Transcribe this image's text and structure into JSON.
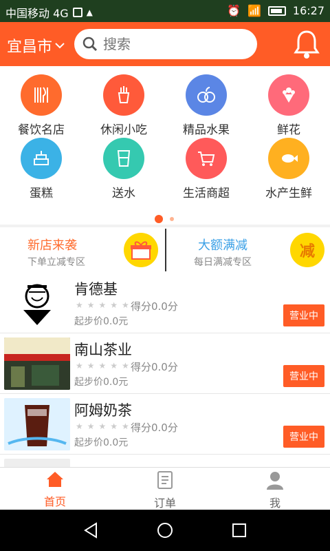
{
  "status_bar": {
    "carrier": "中国移动 4G",
    "time": "16:27"
  },
  "header": {
    "city": "宜昌市",
    "search_placeholder": "搜索"
  },
  "categories": [
    {
      "label": "餐饮名店",
      "color": "#ff6b2d",
      "icon": "utensils-icon"
    },
    {
      "label": "休闲小吃",
      "color": "#ff5a3a",
      "icon": "fries-icon"
    },
    {
      "label": "精品水果",
      "color": "#5b86e5",
      "icon": "fruit-icon"
    },
    {
      "label": "鲜花",
      "color": "#ff6a7a",
      "icon": "flower-icon"
    },
    {
      "label": "蛋糕",
      "color": "#3bb2e6",
      "icon": "cake-icon"
    },
    {
      "label": "送水",
      "color": "#35c9b0",
      "icon": "water-cup-icon"
    },
    {
      "label": "生活商超",
      "color": "#ff5a5a",
      "icon": "cart-icon"
    },
    {
      "label": "水产生鲜",
      "color": "#ffb020",
      "icon": "fish-icon"
    }
  ],
  "promos": [
    {
      "title": "新店来袭",
      "subtitle": "下单立减专区",
      "title_color": "#ff6b2d",
      "icon": "gift-box-icon"
    },
    {
      "title": "大额满减",
      "subtitle": "每日满减专区",
      "title_color": "#3aa0e6",
      "badge": "减",
      "icon": "discount-badge-icon"
    }
  ],
  "stores": [
    {
      "name": "肯德基",
      "score": "得分0.0分",
      "min_price": "起步价0.0元",
      "status": "营业中"
    },
    {
      "name": "南山茶业",
      "score": "得分0.0分",
      "min_price": "起步价0.0元",
      "status": "营业中"
    },
    {
      "name": "阿姆奶茶",
      "score": "得分0.0分",
      "min_price": "起步价0.0元",
      "status": "营业中"
    }
  ],
  "tabs": [
    {
      "label": "首页",
      "active": true
    },
    {
      "label": "订单",
      "active": false
    },
    {
      "label": "我",
      "active": false
    }
  ]
}
